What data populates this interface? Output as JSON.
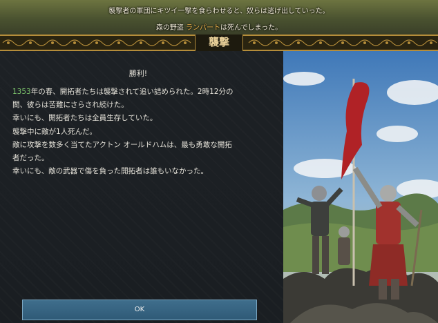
{
  "notifications": {
    "line1": "襲撃者の軍団にキツイ一撃を食らわせると、奴らは逃げ出していった。",
    "line2_prefix": "森の野盗 ",
    "line2_name": "ランパート",
    "line2_suffix": "は死んでしまった。"
  },
  "dialog": {
    "title": "襲撃",
    "heading": "勝利!",
    "paragraph": {
      "year": "1353",
      "line1_rest": "年の春、開拓者たちは襲撃されて追い詰められた。2時12分の",
      "line2": "間、彼らは苦難にさらされ続けた。",
      "line3": "幸いにも、開拓者たちは全員生存していた。",
      "line4": "襲撃中に敵が1人死んだ。",
      "line5": "敵に攻撃を数多く当てたアクトン オールドハムは、最も勇敢な開拓",
      "line6": "者だった。",
      "line7": "幸いにも、敵の武器で傷を負った開拓者は誰もいなかった。"
    },
    "ok_label": "OK"
  },
  "colors": {
    "accent_gold": "#b58d3a",
    "year_green": "#7cc46c",
    "name_orange": "#e8b04a",
    "button_blue": "#2f5a77"
  }
}
